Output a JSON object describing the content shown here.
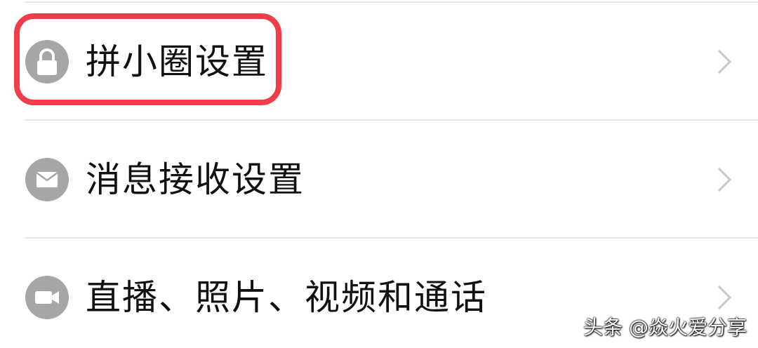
{
  "settings_list": {
    "items": [
      {
        "label": "拼小圈设置",
        "icon": "lock-icon"
      },
      {
        "label": "消息接收设置",
        "icon": "envelope-icon"
      },
      {
        "label": "直播、照片、视频和通话",
        "icon": "video-camera-icon"
      }
    ]
  },
  "colors": {
    "highlight": "#ef3e4a",
    "icon_bg": "#a6a6a6",
    "chevron": "#c8c8c8",
    "divider": "#e6e6e6",
    "text": "#111111"
  },
  "watermark": {
    "text": "头条 @焱火爱分享"
  }
}
